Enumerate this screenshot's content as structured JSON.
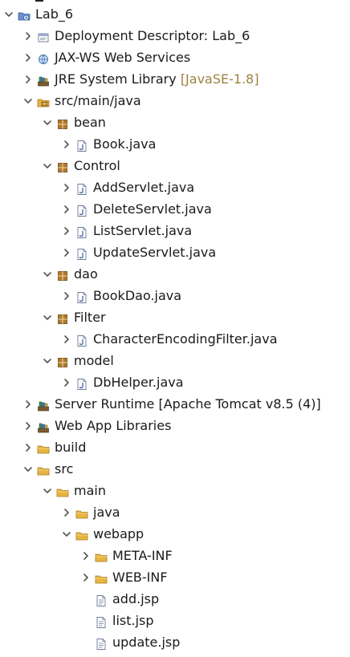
{
  "tree": {
    "rows": [
      {
        "label": "Lab_6",
        "suffix": "",
        "depth": 0,
        "expander": "expanded",
        "icon": "project-icon"
      },
      {
        "label": "Deployment Descriptor: Lab_6",
        "suffix": "",
        "depth": 1,
        "expander": "collapsed",
        "icon": "deployment-descriptor-icon"
      },
      {
        "label": "JAX-WS Web Services",
        "suffix": "",
        "depth": 1,
        "expander": "collapsed",
        "icon": "web-services-icon"
      },
      {
        "label": "JRE System Library ",
        "suffix": "[JavaSE-1.8]",
        "depth": 1,
        "expander": "collapsed",
        "icon": "library-icon"
      },
      {
        "label": "src/main/java",
        "suffix": "",
        "depth": 1,
        "expander": "expanded",
        "icon": "source-folder-icon"
      },
      {
        "label": "bean",
        "suffix": "",
        "depth": 2,
        "expander": "expanded",
        "icon": "package-icon"
      },
      {
        "label": "Book.java",
        "suffix": "",
        "depth": 3,
        "expander": "collapsed",
        "icon": "java-file-icon"
      },
      {
        "label": "Control",
        "suffix": "",
        "depth": 2,
        "expander": "expanded",
        "icon": "package-icon"
      },
      {
        "label": "AddServlet.java",
        "suffix": "",
        "depth": 3,
        "expander": "collapsed",
        "icon": "java-file-icon"
      },
      {
        "label": "DeleteServlet.java",
        "suffix": "",
        "depth": 3,
        "expander": "collapsed",
        "icon": "java-file-icon"
      },
      {
        "label": "ListServlet.java",
        "suffix": "",
        "depth": 3,
        "expander": "collapsed",
        "icon": "java-file-icon"
      },
      {
        "label": "UpdateServlet.java",
        "suffix": "",
        "depth": 3,
        "expander": "collapsed",
        "icon": "java-file-icon"
      },
      {
        "label": "dao",
        "suffix": "",
        "depth": 2,
        "expander": "expanded",
        "icon": "package-icon"
      },
      {
        "label": "BookDao.java",
        "suffix": "",
        "depth": 3,
        "expander": "collapsed",
        "icon": "java-file-icon"
      },
      {
        "label": "Filter",
        "suffix": "",
        "depth": 2,
        "expander": "expanded",
        "icon": "package-icon"
      },
      {
        "label": "CharacterEncodingFilter.java",
        "suffix": "",
        "depth": 3,
        "expander": "collapsed",
        "icon": "java-file-icon"
      },
      {
        "label": "model",
        "suffix": "",
        "depth": 2,
        "expander": "expanded",
        "icon": "package-icon"
      },
      {
        "label": "DbHelper.java",
        "suffix": "",
        "depth": 3,
        "expander": "collapsed",
        "icon": "java-file-icon"
      },
      {
        "label": "Server Runtime [Apache Tomcat v8.5 (4)]",
        "suffix": "",
        "depth": 1,
        "expander": "collapsed",
        "icon": "library-icon"
      },
      {
        "label": "Web App Libraries",
        "suffix": "",
        "depth": 1,
        "expander": "collapsed",
        "icon": "library-icon"
      },
      {
        "label": "build",
        "suffix": "",
        "depth": 1,
        "expander": "collapsed",
        "icon": "folder-icon"
      },
      {
        "label": "src",
        "suffix": "",
        "depth": 1,
        "expander": "expanded",
        "icon": "folder-icon"
      },
      {
        "label": "main",
        "suffix": "",
        "depth": 2,
        "expander": "expanded",
        "icon": "folder-icon"
      },
      {
        "label": "java",
        "suffix": "",
        "depth": 3,
        "expander": "collapsed",
        "icon": "folder-icon"
      },
      {
        "label": "webapp",
        "suffix": "",
        "depth": 3,
        "expander": "expanded",
        "icon": "folder-icon"
      },
      {
        "label": "META-INF",
        "suffix": "",
        "depth": 4,
        "expander": "collapsed",
        "icon": "folder-icon"
      },
      {
        "label": "WEB-INF",
        "suffix": "",
        "depth": 4,
        "expander": "collapsed",
        "icon": "folder-icon"
      },
      {
        "label": "add.jsp",
        "suffix": "",
        "depth": 4,
        "expander": "none",
        "icon": "jsp-file-icon"
      },
      {
        "label": "list.jsp",
        "suffix": "",
        "depth": 4,
        "expander": "none",
        "icon": "jsp-file-icon"
      },
      {
        "label": "update.jsp",
        "suffix": "",
        "depth": 4,
        "expander": "none",
        "icon": "jsp-file-icon"
      }
    ]
  },
  "colors": {
    "text": "#1a1a1a",
    "muted_suffix": "#9a8340",
    "chevron": "#555555",
    "folder": "#e8b441",
    "package": "#b07b2c",
    "java_file": "#5b6fa8",
    "library": "#7b5a2f"
  }
}
